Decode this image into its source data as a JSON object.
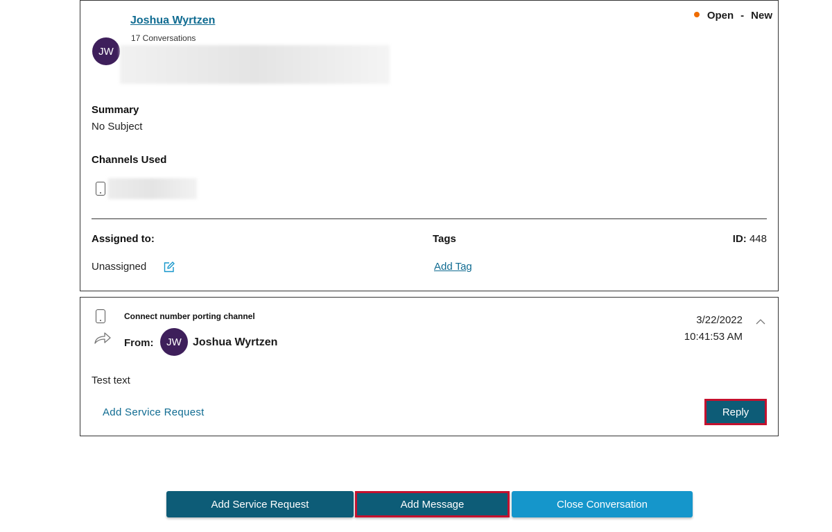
{
  "conversation": {
    "customer_initials": "JW",
    "customer_name": "Joshua Wyrtzen",
    "conversation_count": "17 Conversations",
    "status": {
      "state": "Open",
      "separator": "-",
      "sub_state": "New",
      "dot_color": "#ef6c00"
    },
    "summary_label": "Summary",
    "summary_value": "No Subject",
    "channels_label": "Channels Used",
    "channel_icon": "phone-icon",
    "assigned_label": "Assigned to:",
    "assigned_value": "Unassigned",
    "tags_label": "Tags",
    "add_tag_link": "Add Tag",
    "id_label": "ID:",
    "id_value": "448"
  },
  "message": {
    "channel_icon": "phone-icon",
    "subject": "Connect number porting channel",
    "from_label": "From:",
    "sender_initials": "JW",
    "sender_name": "Joshua Wyrtzen",
    "date": "3/22/2022",
    "time": "10:41:53 AM",
    "body": "Test text",
    "add_service_request_link": "Add Service Request",
    "reply_button": "Reply"
  },
  "actions": {
    "add_service_request": "Add Service Request",
    "add_message": "Add Message",
    "close_conversation": "Close Conversation"
  },
  "colors": {
    "avatar": "#3e1f5b",
    "link": "#0f6b91",
    "primary_button": "#0d5c77",
    "secondary_button": "#1596cb",
    "highlight_border": "#c4112e"
  }
}
